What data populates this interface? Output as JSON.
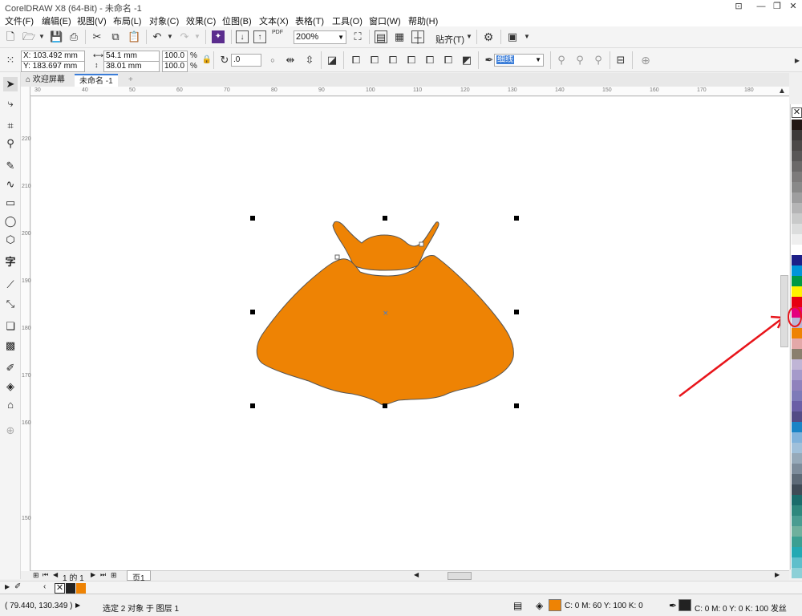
{
  "window": {
    "title": "CorelDRAW X8 (64-Bit) - 未命名 -1"
  },
  "menu": [
    "文件(F)",
    "编辑(E)",
    "视图(V)",
    "布局(L)",
    "对象(C)",
    "效果(C)",
    "位图(B)",
    "文本(X)",
    "表格(T)",
    "工具(O)",
    "窗口(W)",
    "帮助(H)"
  ],
  "toolbar": {
    "zoom": "200%",
    "snap_label": "贴齐(T)",
    "pdf_label": "PDF"
  },
  "property_bar": {
    "x": "X: 103.492 mm",
    "y": "Y: 183.697 mm",
    "width": "54.1 mm",
    "height": "38.01 mm",
    "scale_w": "100.0",
    "scale_h": "100.0",
    "percent": "%",
    "angle": ".0",
    "outline": "细线"
  },
  "tabs": {
    "welcome": "欢迎屏幕",
    "doc": "未命名 -1"
  },
  "ruler_top": [
    "30",
    "40",
    "50",
    "60",
    "70",
    "80",
    "90",
    "100",
    "110",
    "120",
    "130",
    "140",
    "150",
    "160",
    "170",
    "180"
  ],
  "ruler_left": [
    "220",
    "210",
    "200",
    "190",
    "180",
    "170",
    "160",
    "150"
  ],
  "page_nav": {
    "page_info": "1 的 1",
    "page_tab": "页1"
  },
  "status": {
    "coords": "( 79.440, 130.349 )",
    "selection": "选定 2 对象 于 图层 1",
    "fill_text": "C: 0 M: 60 Y: 100 K: 0",
    "outline_text": "C: 0 M: 0 Y: 0 K: 100  发丝"
  },
  "colors": {
    "fill": "#ee8304",
    "outline": "#222222",
    "highlight": "#e8151b"
  },
  "palette": [
    "#231815",
    "#3d3a39",
    "#4c4948",
    "#595757",
    "#6b6969",
    "#7d7b7b",
    "#898989",
    "#9e9e9f",
    "#b5b5b6",
    "#c9caca",
    "#dcdddd",
    "#efefef",
    "#ffffff",
    "#1d2088",
    "#0095d9",
    "#009944",
    "#fff100",
    "#e60012",
    "#e4007f",
    "#b8b8d8",
    "#ee8304",
    "#e3a8a8",
    "#8a7f6e",
    "#c0b5d6",
    "#a59aca",
    "#8f82bc",
    "#7d7ab8",
    "#6a5fa6",
    "#534c86",
    "#1a84c6",
    "#80b2db",
    "#a0c0da",
    "#96a9b9",
    "#7d8c9b",
    "#5d6a77",
    "#3f4b56",
    "#1b6c6b",
    "#2f877d",
    "#4a9c91",
    "#6fb09d",
    "#3c9f92",
    "#24a9b3",
    "#5fbfcb",
    "#8dd0d7"
  ]
}
